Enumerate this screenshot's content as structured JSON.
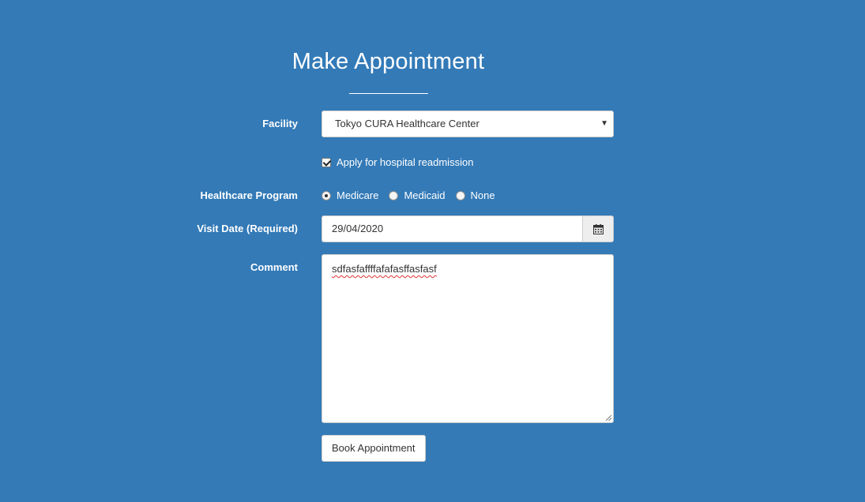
{
  "form": {
    "title": "Make Appointment",
    "facility": {
      "label": "Facility",
      "selected": "Tokyo CURA Healthcare Center"
    },
    "readmission": {
      "label": "Apply for hospital readmission",
      "checked": true
    },
    "program": {
      "label": "Healthcare Program",
      "options": [
        "Medicare",
        "Medicaid",
        "None"
      ],
      "selected": "Medicare"
    },
    "visit_date": {
      "label": "Visit Date (Required)",
      "value": "29/04/2020"
    },
    "comment": {
      "label": "Comment",
      "value": "sdfasfaffffafafasffasfasf"
    },
    "submit_label": "Book Appointment"
  },
  "colors": {
    "background": "#337ab7",
    "text_light": "#ffffff",
    "input_bg": "#ffffff"
  },
  "icons": {
    "select_caret": "caret-down-icon",
    "calendar": "calendar-icon"
  }
}
